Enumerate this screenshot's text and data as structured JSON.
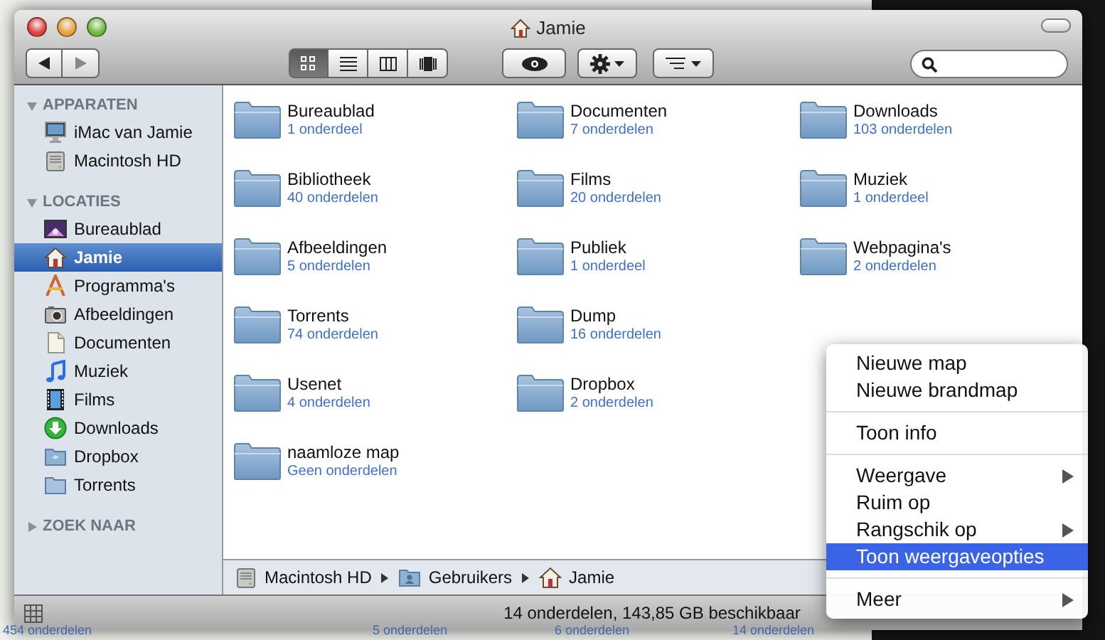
{
  "background_page": {
    "item_counts": [
      "454 onderdelen",
      "5 onderdelen",
      "6 onderdelen",
      "14 onderdelen"
    ]
  },
  "window": {
    "title": "Jamie"
  },
  "toolbar": {
    "view_buttons": [
      {
        "selected": true
      },
      {
        "selected": false
      },
      {
        "selected": false
      },
      {
        "selected": false
      }
    ]
  },
  "sidebar": {
    "sections": [
      {
        "heading": "APPARATEN",
        "expanded": true,
        "items": [
          {
            "label": "iMac van Jamie",
            "selected": false
          },
          {
            "label": "Macintosh HD",
            "selected": false
          }
        ]
      },
      {
        "heading": "LOCATIES",
        "expanded": true,
        "items": [
          {
            "label": "Bureaublad",
            "selected": false
          },
          {
            "label": "Jamie",
            "selected": true
          },
          {
            "label": "Programma's",
            "selected": false
          },
          {
            "label": "Afbeeldingen",
            "selected": false
          },
          {
            "label": "Documenten",
            "selected": false
          },
          {
            "label": "Muziek",
            "selected": false
          },
          {
            "label": "Films",
            "selected": false
          },
          {
            "label": "Downloads",
            "selected": false
          },
          {
            "label": "Dropbox",
            "selected": false
          },
          {
            "label": "Torrents",
            "selected": false
          }
        ]
      },
      {
        "heading": "ZOEK NAAR",
        "expanded": false
      }
    ]
  },
  "files": {
    "columns": [
      [
        {
          "name": "Bureaublad",
          "count": "1 onderdeel"
        },
        {
          "name": "Bibliotheek",
          "count": "40 onderdelen"
        },
        {
          "name": "Afbeeldingen",
          "count": "5 onderdelen"
        },
        {
          "name": "Torrents",
          "count": "74 onderdelen"
        },
        {
          "name": "Usenet",
          "count": "4 onderdelen"
        },
        {
          "name": "naamloze map",
          "count": "Geen onderdelen"
        }
      ],
      [
        {
          "name": "Documenten",
          "count": "7 onderdelen"
        },
        {
          "name": "Films",
          "count": "20 onderdelen"
        },
        {
          "name": "Publiek",
          "count": "1 onderdeel"
        },
        {
          "name": "Dump",
          "count": "16 onderdelen"
        },
        {
          "name": "Dropbox",
          "count": "2 onderdelen"
        }
      ],
      [
        {
          "name": "Downloads",
          "count": "103 onderdelen"
        },
        {
          "name": "Muziek",
          "count": "1 onderdeel"
        },
        {
          "name": "Webpagina's",
          "count": "2 onderdelen"
        }
      ]
    ]
  },
  "path_bar": [
    "Macintosh HD",
    "Gebruikers",
    "Jamie"
  ],
  "status_bar": "14 onderdelen, 143,85 GB beschikbaar",
  "context_menu": {
    "groups": [
      [
        {
          "label": "Nieuwe map",
          "submenu": false,
          "selected": false
        },
        {
          "label": "Nieuwe brandmap",
          "submenu": false,
          "selected": false
        }
      ],
      [
        {
          "label": "Toon info",
          "submenu": false,
          "selected": false
        }
      ],
      [
        {
          "label": "Weergave",
          "submenu": true,
          "selected": false
        },
        {
          "label": "Ruim op",
          "submenu": false,
          "selected": false
        },
        {
          "label": "Rangschik op",
          "submenu": true,
          "selected": false
        },
        {
          "label": "Toon weergaveopties",
          "submenu": false,
          "selected": true
        }
      ],
      [
        {
          "label": "Meer",
          "submenu": true,
          "selected": false
        }
      ]
    ]
  }
}
